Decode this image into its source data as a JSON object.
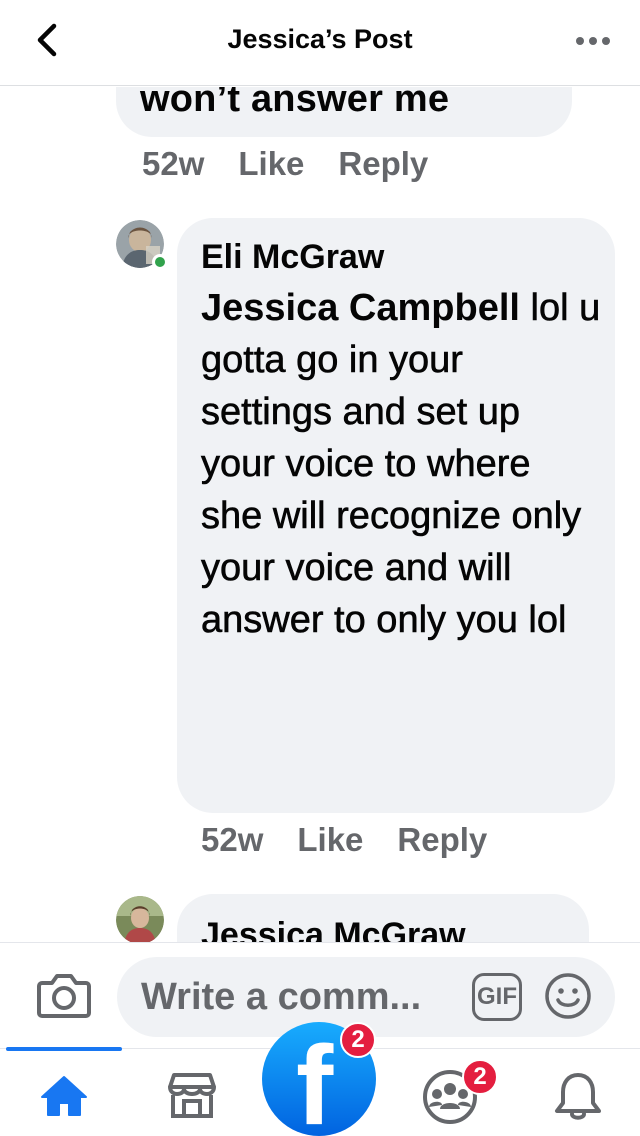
{
  "header": {
    "title": "Jessica’s Post",
    "back_icon": "chevron-left-icon",
    "more_icon": "more-dots-icon"
  },
  "previous_comment": {
    "text_tail": "won’t answer me",
    "time": "52w",
    "like": "Like",
    "reply": "Reply"
  },
  "comment": {
    "author": "Eli McGraw",
    "mention": "Jessica Campbell",
    "text": " lol u gotta go in your settings and set up your voice to where she will recognize only your voice and will answer to only you lol",
    "time": "52w",
    "like": "Like",
    "reply": "Reply",
    "online": true
  },
  "next_comment": {
    "author": "Jessica McGraw"
  },
  "composer": {
    "placeholder": "Write a comm...",
    "gif_label": "GIF",
    "camera_icon": "camera-icon",
    "emoji_icon": "smile-icon"
  },
  "tabbar": {
    "home_icon": "home-icon",
    "marketplace_icon": "marketplace-icon",
    "facebook_badge": "2",
    "groups_badge": "2",
    "notifications_icon": "bell-icon"
  },
  "colors": {
    "accent": "#1877f2",
    "bubble": "#f0f2f5",
    "meta_text": "#65676b",
    "badge": "#e41e3f",
    "online": "#31a24c"
  }
}
